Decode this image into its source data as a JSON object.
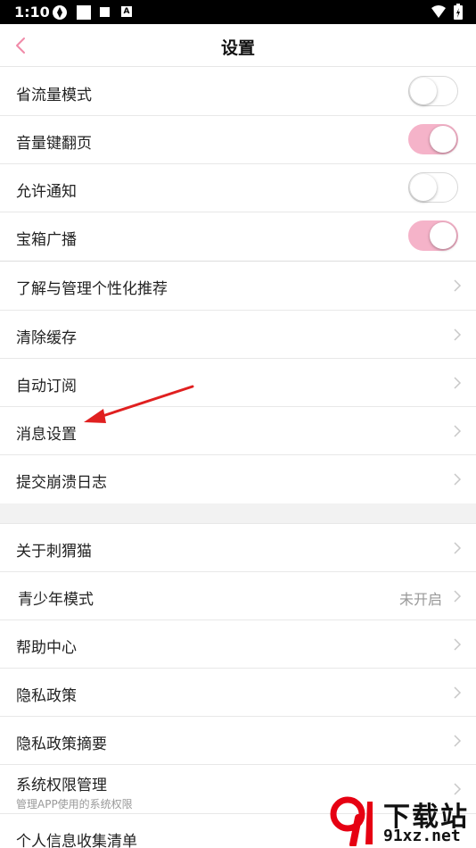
{
  "status_bar": {
    "time": "1:10",
    "a_badge": "A"
  },
  "header": {
    "title": "设置"
  },
  "toggles": [
    {
      "label": "省流量模式",
      "on": false
    },
    {
      "label": "音量键翻页",
      "on": true
    },
    {
      "label": "允许通知",
      "on": false
    },
    {
      "label": "宝箱广播",
      "on": true
    }
  ],
  "nav_group_1": [
    {
      "label": "了解与管理个性化推荐"
    },
    {
      "label": "清除缓存"
    },
    {
      "label": "自动订阅"
    },
    {
      "label": "消息设置"
    },
    {
      "label": "提交崩溃日志"
    }
  ],
  "nav_group_2": [
    {
      "label": "关于刺猬猫"
    },
    {
      "label": "青少年模式",
      "value": "未开启"
    },
    {
      "label": "帮助中心"
    },
    {
      "label": "隐私政策"
    },
    {
      "label": "隐私政策摘要"
    },
    {
      "label": "系统权限管理",
      "sub": "管理APP使用的系统权限"
    },
    {
      "label": "个人信息收集清单"
    }
  ],
  "watermark": {
    "line1": "下载站",
    "line2": "91xz.net"
  },
  "colors": {
    "accent_pink": "#f5b3c9",
    "back_arrow": "#f08aa8",
    "annotation_arrow": "#e02020"
  }
}
